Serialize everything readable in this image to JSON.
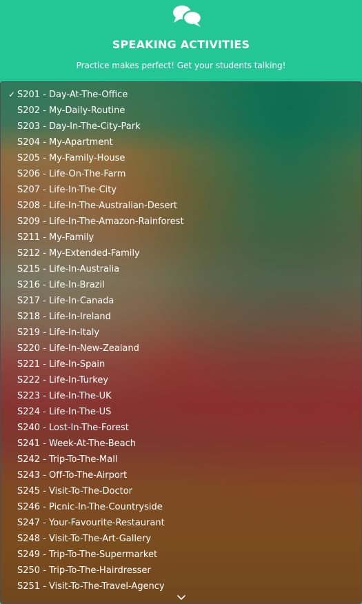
{
  "header": {
    "icon": "chat-bubbles-icon",
    "title": "SPEAKING ACTIVITIES",
    "subtitle": "Practice makes perfect! Get your students talking!"
  },
  "colors": {
    "header_bg": "#23c796",
    "text": "#ffffff"
  },
  "dropdown": {
    "selected_index": 0,
    "check_mark": "✓",
    "scroll_indicator": "chevron-down-icon",
    "options": [
      "S201 - Day-At-The-Office",
      "S202 - My-Daily-Routine",
      "S203 - Day-In-The-City-Park",
      "S204 - My-Apartment",
      "S205 - My-Family-House",
      "S206 - Life-On-The-Farm",
      "S207 - Life-In-The-City",
      "S208 - Life-In-The-Australian-Desert",
      "S209 - Life-In-The-Amazon-Rainforest",
      "S211 - My-Family",
      "S212 - My-Extended-Family",
      "S215 - Life-In-Australia",
      "S216 - Life-In-Brazil",
      "S217 - Life-In-Canada",
      "S218 - Life-In-Ireland",
      "S219 - Life-In-Italy",
      "S220 - Life-In-New-Zealand",
      "S221 - Life-In-Spain",
      "S222 - Life-In-Turkey",
      "S223 - Life-In-The-UK",
      "S224 - Life-In-The-US",
      "S240 - Lost-In-The-Forest",
      "S241 - Week-At-The-Beach",
      "S242 - Trip-To-The-Mall",
      "S243 - Off-To-The-Airport",
      "S245 - Visit-To-The-Doctor",
      "S246 - Picnic-In-The-Countryside",
      "S247 - Your-Favourite-Restaurant",
      "S248 - Visit-To-The-Art-Gallery",
      "S249 - Trip-To-The-Supermarket",
      "S250 - Trip-To-The-Hairdresser",
      "S251 - Visit-To-The-Travel-Agency"
    ]
  }
}
